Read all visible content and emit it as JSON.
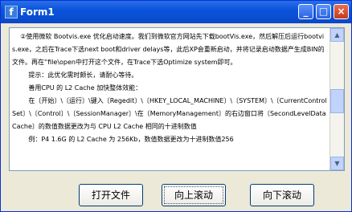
{
  "window": {
    "title": "Form1",
    "icon": "app-icon",
    "controls": {
      "minimize": "_",
      "maximize": "□",
      "close": "×"
    }
  },
  "text": "    ②使用微软 Bootvis.exe 优化启动速度。我们到微软官方网站先下载bootVis.exe，然后解压后运行bootvis.exe，之后在Trace下选next boot和driver delays等，此后XP会重新启动，并将记录启动数据产生成BIN的文件。再在“file\\open中打开这个文件，在Trace下选Optimize system即可。\n        提示：此优化需时颇长，请耐心等待。\n        善用CPU 的 L2 Cache 加快整体效能：\n        在〔开始〕\\〔运行〕\\键入〔Regedit〕\\〔HKEY_LOCAL_MACHINE〕\\〔SYSTEM〕\\〔CurrentControlSet〕\\〔Control〕\\〔SessionManager〕\\在〔MemoryManagement〕的右边窗口将〔SecondLevelDataCache〕的数值数据更改为与 CPU L2 Cache 相同的十进制数值\n        例：P4 1.6G 的 L2 Cache 为 256Kb，数值数据更改为十进制数值256",
  "buttons": {
    "open": "打开文件",
    "scroll_up": "向上滚动",
    "scroll_down": "向下滚动"
  },
  "scrollbar": {
    "position": 0.45
  }
}
